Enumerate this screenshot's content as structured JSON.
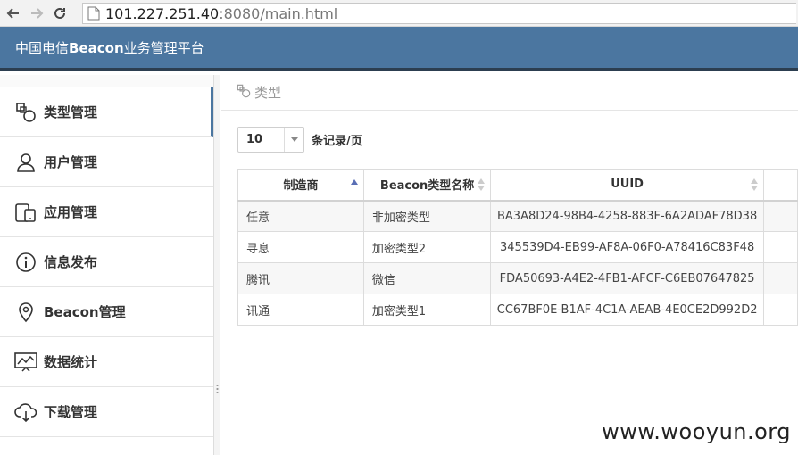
{
  "browser": {
    "url_host": "101.227.251.40",
    "url_rest": ":8080/main.html"
  },
  "header": {
    "title_prefix": "中国电信",
    "title_bold": "Beacon",
    "title_suffix": "业务管理平台"
  },
  "sidebar": {
    "items": [
      {
        "label": "类型管理",
        "icon": "type-icon"
      },
      {
        "label": "用户管理",
        "icon": "user-icon"
      },
      {
        "label": "应用管理",
        "icon": "devices-icon"
      },
      {
        "label": "信息发布",
        "icon": "info-icon"
      },
      {
        "label": "Beacon管理",
        "icon": "location-pin-icon"
      },
      {
        "label": "数据统计",
        "icon": "chart-icon"
      },
      {
        "label": "下载管理",
        "icon": "cloud-download-icon"
      }
    ]
  },
  "main": {
    "crumb": "类型",
    "page_size": "10",
    "page_size_label": "条记录/页",
    "table": {
      "headers": [
        "制造商",
        "Beacon类型名称",
        "UUID",
        ""
      ],
      "rows": [
        [
          "任意",
          "非加密类型",
          "BA3A8D24-98B4-4258-883F-6A2ADAF78D38"
        ],
        [
          "寻息",
          "加密类型2",
          "345539D4-EB99-AF8A-06F0-A78416C83F48"
        ],
        [
          "腾讯",
          "微信",
          "FDA50693-A4E2-4FB1-AFCF-C6EB07647825"
        ],
        [
          "讯通",
          "加密类型1",
          "CC67BF0E-B1AF-4C1A-AEAB-4E0CE2D992D2"
        ]
      ]
    }
  },
  "watermark": "www.wooyun.org",
  "colors": {
    "header_bg": "#4b76a0",
    "header_border": "#2c3e50"
  }
}
